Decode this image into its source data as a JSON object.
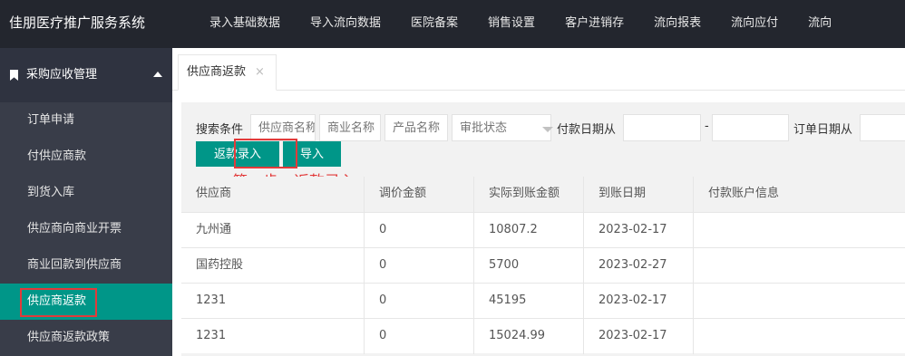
{
  "app": {
    "title": "佳朋医疗推广服务系统"
  },
  "topnav": [
    {
      "label": "录入基础数据"
    },
    {
      "label": "导入流向数据"
    },
    {
      "label": "医院备案"
    },
    {
      "label": "销售设置"
    },
    {
      "label": "客户进销存"
    },
    {
      "label": "流向报表"
    },
    {
      "label": "流向应付"
    },
    {
      "label": "流向"
    }
  ],
  "sidebar": {
    "section_title": "采购应收管理",
    "items": [
      {
        "label": "订单申请"
      },
      {
        "label": "付供应商款"
      },
      {
        "label": "到货入库"
      },
      {
        "label": "供应商向商业开票"
      },
      {
        "label": "商业回款到供应商"
      },
      {
        "label": "供应商返款",
        "active": true
      },
      {
        "label": "供应商返款政策"
      }
    ]
  },
  "tabs": [
    {
      "label": "供应商返款",
      "close": "×"
    }
  ],
  "search": {
    "label": "搜索条件",
    "supplier_placeholder": "供应商名称",
    "business_placeholder": "商业名称",
    "product_placeholder": "产品名称",
    "approval_placeholder": "审批状态",
    "pay_date_label": "付款日期从",
    "date_separator": "-",
    "order_date_label": "订单日期从"
  },
  "buttons": {
    "entry": "返款录入",
    "import": "导入"
  },
  "annotation": "第一步，返款录入",
  "table": {
    "headers": [
      "供应商",
      "调价金额",
      "实际到账金额",
      "到账日期",
      "付款账户信息"
    ],
    "rows": [
      [
        "九州通",
        "0",
        "10807.2",
        "2023-02-17",
        ""
      ],
      [
        "国药控股",
        "0",
        "5700",
        "2023-02-27",
        ""
      ],
      [
        "1231",
        "0",
        "45195",
        "2023-02-17",
        ""
      ],
      [
        "1231",
        "0",
        "15024.99",
        "2023-02-17",
        ""
      ]
    ]
  },
  "colors": {
    "topbar": "#23262e",
    "sidebar": "#393d49",
    "accent": "#009688",
    "highlight": "#e23a3a"
  }
}
